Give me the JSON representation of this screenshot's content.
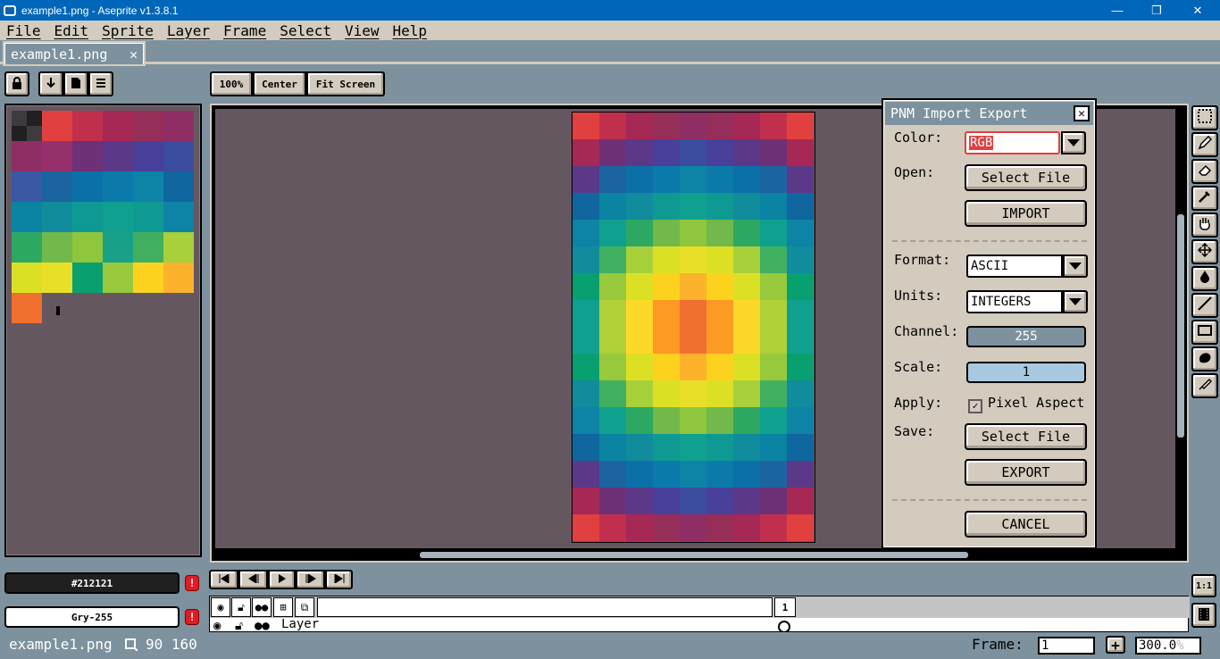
{
  "window": {
    "title": "example1.png - Aseprite v1.3.8.1",
    "min_label": "—",
    "max_label": "❐",
    "close_label": "✕"
  },
  "menu": [
    "File",
    "Edit",
    "Sprite",
    "Layer",
    "Frame",
    "Select",
    "View",
    "Help"
  ],
  "tab": {
    "label": "example1.png",
    "close_label": "✕"
  },
  "zoom_buttons": {
    "zoom": "100%",
    "center": "Center",
    "fit": "Fit Screen"
  },
  "palette": {
    "swatches": [
      "#3e3a3e",
      "#212021",
      "#e04040",
      "#c0304c",
      "#a62854",
      "#962e5a",
      "#8e2e64",
      "#8e2e64",
      "#96306c",
      "#6e3076",
      "#5c3888",
      "#48409a",
      "#3c4c9e",
      "#3a58a4",
      "#1c64a0",
      "#0c70a8",
      "#0b7aaa",
      "#0d84a6",
      "#10669e",
      "#0a84a2",
      "#108c9c",
      "#0e9a92",
      "#10a090",
      "#0e9a92",
      "#0d84a6",
      "#2ca862",
      "#72b84a",
      "#8ec63e",
      "#18a088",
      "#40b060",
      "#a8d03a",
      "#dce024",
      "#e8e028",
      "#08a070",
      "#98c83c",
      "#fcd21e",
      "#fcb22a",
      "#b0d038",
      "#fcd828",
      "#fc9a24",
      "#f07030"
    ],
    "fg_color": "#212021",
    "bg_color": "Gry-255",
    "fg_hex": "#212121",
    "warn_glyph": "!"
  },
  "sprite": {
    "cols": 9,
    "rows": 16,
    "pixels": [
      "#e04040",
      "#c0304c",
      "#a62854",
      "#962e5a",
      "#8e2e64",
      "#962e5a",
      "#a62854",
      "#c0304c",
      "#e04040",
      "#a62854",
      "#6e3076",
      "#5c3888",
      "#48409a",
      "#3c4c9e",
      "#48409a",
      "#5c3888",
      "#6e3076",
      "#a62854",
      "#5c3888",
      "#1c64a0",
      "#0c70a8",
      "#0b7aaa",
      "#0d84a6",
      "#0b7aaa",
      "#0c70a8",
      "#1c64a0",
      "#5c3888",
      "#10669e",
      "#0a84a2",
      "#108c9c",
      "#0e9a92",
      "#10a090",
      "#0e9a92",
      "#108c9c",
      "#0a84a2",
      "#10669e",
      "#0d84a6",
      "#10a090",
      "#2ca862",
      "#72b84a",
      "#8ec63e",
      "#72b84a",
      "#2ca862",
      "#10a090",
      "#0d84a6",
      "#108c9c",
      "#40b060",
      "#a8d03a",
      "#dce024",
      "#e8e028",
      "#dce024",
      "#a8d03a",
      "#40b060",
      "#108c9c",
      "#08a070",
      "#98c83c",
      "#dce024",
      "#fcd21e",
      "#fcb22a",
      "#fcd21e",
      "#dce024",
      "#98c83c",
      "#08a070",
      "#10a090",
      "#b0d038",
      "#fcd828",
      "#fc9a24",
      "#f07030",
      "#fc9a24",
      "#fcd828",
      "#b0d038",
      "#10a090",
      "#10a090",
      "#b0d038",
      "#fcd828",
      "#fc9a24",
      "#f07030",
      "#fc9a24",
      "#fcd828",
      "#b0d038",
      "#10a090",
      "#08a070",
      "#98c83c",
      "#dce024",
      "#fcd21e",
      "#fcb22a",
      "#fcd21e",
      "#dce024",
      "#98c83c",
      "#08a070",
      "#108c9c",
      "#40b060",
      "#a8d03a",
      "#dce024",
      "#e8e028",
      "#dce024",
      "#a8d03a",
      "#40b060",
      "#108c9c",
      "#0d84a6",
      "#10a090",
      "#2ca862",
      "#72b84a",
      "#8ec63e",
      "#72b84a",
      "#2ca862",
      "#10a090",
      "#0d84a6",
      "#10669e",
      "#0a84a2",
      "#108c9c",
      "#0e9a92",
      "#10a090",
      "#0e9a92",
      "#108c9c",
      "#0a84a2",
      "#10669e",
      "#5c3888",
      "#1c64a0",
      "#0c70a8",
      "#0b7aaa",
      "#0d84a6",
      "#0b7aaa",
      "#0c70a8",
      "#1c64a0",
      "#5c3888",
      "#a62854",
      "#6e3076",
      "#5c3888",
      "#48409a",
      "#3c4c9e",
      "#48409a",
      "#5c3888",
      "#6e3076",
      "#a62854",
      "#e04040",
      "#c0304c",
      "#a62854",
      "#962e5a",
      "#8e2e64",
      "#962e5a",
      "#a62854",
      "#c0304c",
      "#e04040"
    ]
  },
  "dialog": {
    "title": "PNM Import Export",
    "close_label": "✕",
    "color_label": "Color:",
    "color_value": "RGB",
    "open_label": "Open:",
    "select_file_open": "Select File",
    "import_label": "IMPORT",
    "format_label": "Format:",
    "format_value": "ASCII",
    "units_label": "Units:",
    "units_value": "INTEGERS",
    "channel_label": "Channel:",
    "channel_value": "255",
    "scale_label": "Scale:",
    "scale_value": "1",
    "apply_label": "Apply:",
    "pixel_aspect_label": "Pixel Aspect",
    "pixel_aspect_checked": true,
    "save_label": "Save:",
    "select_file_save": "Select File",
    "export_label": "EXPORT",
    "cancel_label": "CANCEL"
  },
  "timeline": {
    "frame_number": "1",
    "layer_name": "Layer"
  },
  "status": {
    "filename": "example1.png",
    "dimensions": "90 160",
    "frame_label": "Frame:",
    "frame_value": "1",
    "add_frame": "+",
    "zoom_value": "300.0",
    "zoom_unit": "%"
  },
  "colors": {
    "accent": "#0066b9",
    "panel": "#d3cbbe",
    "canvas_bg": "#655760",
    "workspace": "#7d929e",
    "warn": "#e21b23"
  }
}
